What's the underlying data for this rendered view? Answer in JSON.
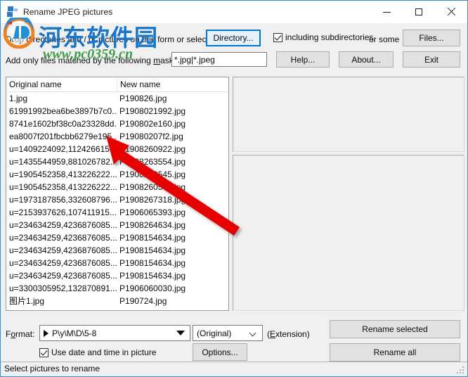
{
  "window": {
    "title": "Rename JPEG pictures",
    "icon": "app-icon",
    "minimize": "minimize",
    "maximize": "maximize",
    "close": "close"
  },
  "form": {
    "drop_hint": "Drop directories and / or pictures on this form or select a",
    "directory_button": "Directory...",
    "including_subdirectories": "including subdirectories,",
    "or_some": "or some",
    "files_button": "Files...",
    "mask_label_pre": "Add only files matched by the following ",
    "mask_label_underline": "m",
    "mask_label_post": "ask(s) :",
    "mask_value": "*.jpg|*.jpeg",
    "help_button": "Help...",
    "about_button": "About...",
    "exit_button": "Exit"
  },
  "list": {
    "columns": [
      "Original name",
      "New name"
    ],
    "rows": [
      {
        "original": "1.jpg",
        "new": "P190826.jpg"
      },
      {
        "original": "61991992bea6be3897b7c0...",
        "new": "P1908021992.jpg"
      },
      {
        "original": "8741e1602bf38c0a23328dd...",
        "new": "P190802e160.jpg"
      },
      {
        "original": "ea8007f201fbcbb6279e195...",
        "new": "P19080207f2.jpg"
      },
      {
        "original": "u=1409224092,112426615...",
        "new": "P1908260922.jpg"
      },
      {
        "original": "u=1435544959,881026782...",
        "new": "P1908263554.jpg"
      },
      {
        "original": "u=1905452358,413226222...",
        "new": "P1908260545.jpg"
      },
      {
        "original": "u=1905452358,413226222...",
        "new": "P1908260545.jpg"
      },
      {
        "original": "u=1973187856,332608796...",
        "new": "P1908267318.jpg"
      },
      {
        "original": "u=2153937626,107411915...",
        "new": "P1906065393.jpg"
      },
      {
        "original": "u=234634259,4236876085...",
        "new": "P1908264634.jpg"
      },
      {
        "original": "u=234634259,4236876085...",
        "new": "P1908154634.jpg"
      },
      {
        "original": "u=234634259,4236876085...",
        "new": "P1908154634.jpg"
      },
      {
        "original": "u=234634259,4236876085...",
        "new": "P1908154634.jpg"
      },
      {
        "original": "u=234634259,4236876085...",
        "new": "P1908154634.jpg"
      },
      {
        "original": "u=3300305952,132870891...",
        "new": "P1906060030.jpg"
      },
      {
        "original": "图片1.jpg",
        "new": "P190724.jpg"
      }
    ]
  },
  "bottom": {
    "format_label_pre": "F",
    "format_label_underline": "o",
    "format_label_post": "rmat:",
    "format_value": "P\\y\\M\\D\\5-8",
    "extension_value": "(Original)",
    "extension_label_pre": "(",
    "extension_label_underline": "E",
    "extension_label_post": "xtension)",
    "use_date_checkbox": "Use date and time in picture",
    "options_button": "Options...",
    "rename_selected_button": "Rename selected",
    "rename_all_button": "Rename all"
  },
  "status": {
    "text": "Select pictures to rename"
  },
  "watermark": {
    "chinese": "河东软件园",
    "url": "www.pc0359.cn"
  },
  "colors": {
    "accent": "#0078d7",
    "window_border": "#3b8fd4",
    "face": "#f0f0f0",
    "button_face": "#e1e1e1",
    "watermark_blue": "#1976c8",
    "watermark_green": "#3f9b46",
    "arrow_red": "#e60000"
  }
}
